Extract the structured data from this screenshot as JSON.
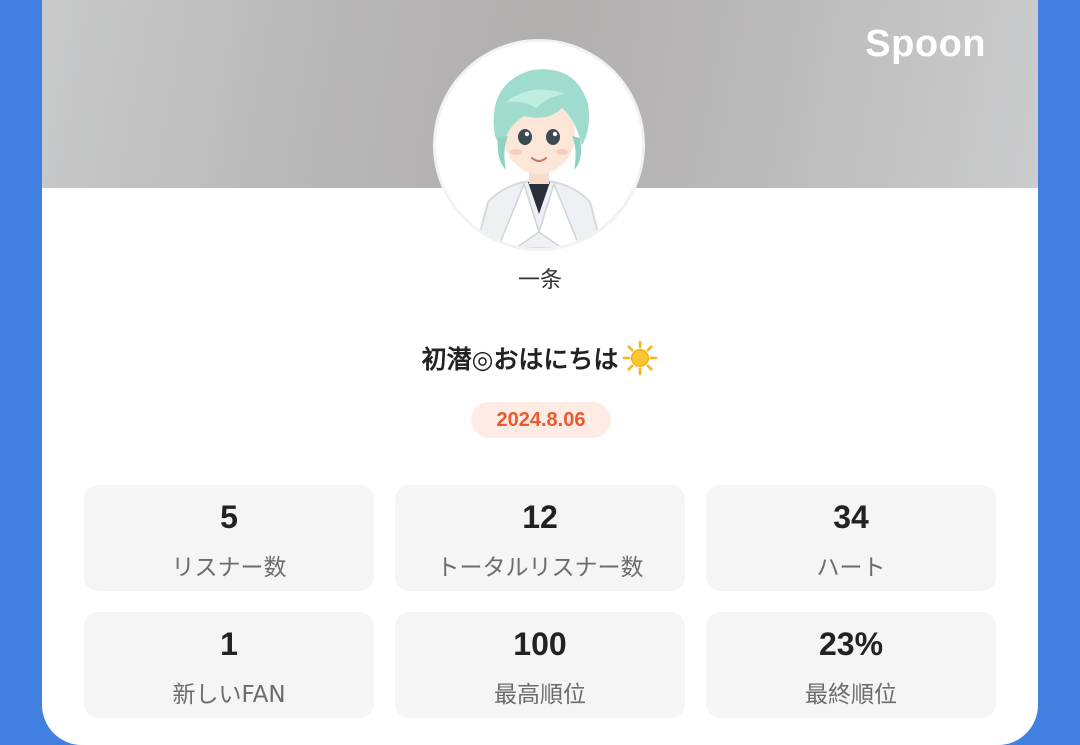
{
  "brand": {
    "name": "Spoon"
  },
  "profile": {
    "nickname": "一条",
    "title": "初潜◎おはにちは",
    "title_icon": "sun-icon",
    "date": "2024.8.06"
  },
  "stats": [
    {
      "value": "5",
      "label": "リスナー数"
    },
    {
      "value": "12",
      "label": "トータルリスナー数"
    },
    {
      "value": "34",
      "label": "ハート"
    },
    {
      "value": "1",
      "label": "新しいFAN"
    },
    {
      "value": "100",
      "label": "最高順位"
    },
    {
      "value": "23%",
      "label": "最終順位"
    }
  ],
  "colors": {
    "page_background": "#4180e0",
    "accent": "#e85a2f",
    "badge_background": "#fdebe4"
  }
}
